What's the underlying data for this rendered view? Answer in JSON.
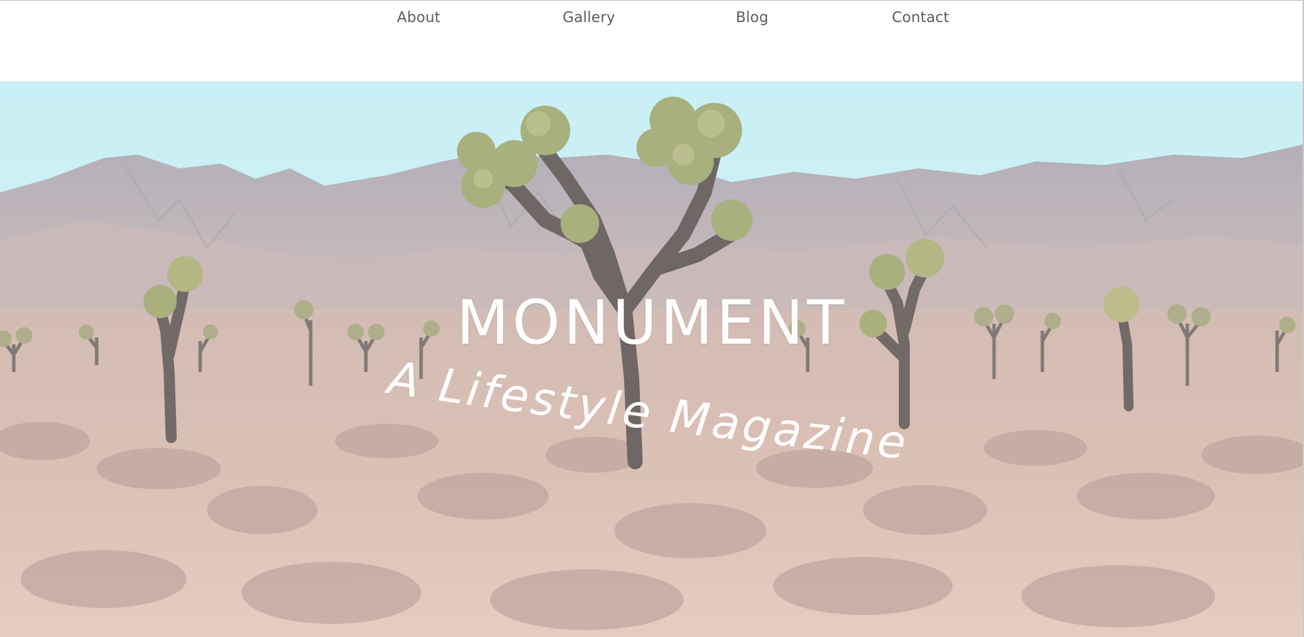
{
  "nav": {
    "items": [
      {
        "label": "About"
      },
      {
        "label": "Gallery"
      },
      {
        "label": "Blog"
      },
      {
        "label": "Contact"
      }
    ]
  },
  "hero": {
    "title": "MONUMENT",
    "tagline": "A Lifestyle Magazine",
    "image_description_icon": "desert-landscape-image"
  },
  "colors": {
    "sky": "#c4eef4",
    "mountains": "#b8a9ad",
    "ground": "#d9b9ad",
    "nav_text": "#5b5b5b",
    "title_text": "#ffffff"
  }
}
